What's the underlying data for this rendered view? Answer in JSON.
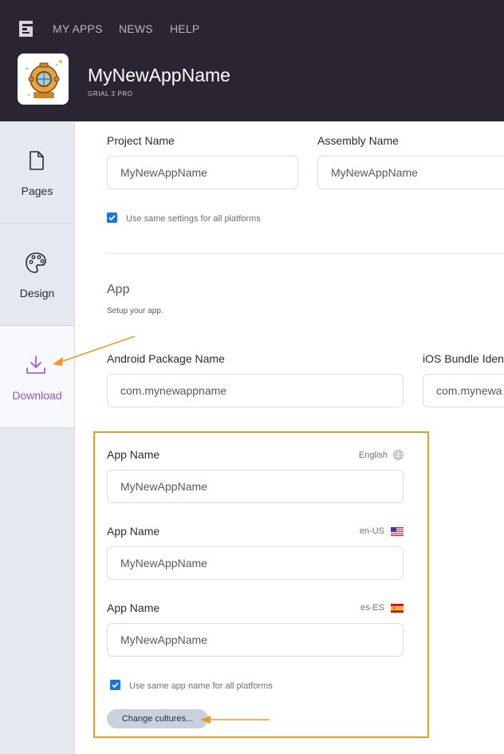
{
  "header": {
    "nav": [
      "MY APPS",
      "NEWS",
      "HELP"
    ],
    "app_title": "MyNewAppName",
    "app_subtitle": "GRIAL 3 PRO"
  },
  "sidebar": {
    "items": [
      {
        "label": "Pages",
        "icon": "page-icon"
      },
      {
        "label": "Design",
        "icon": "palette-icon"
      },
      {
        "label": "Download",
        "icon": "download-icon",
        "active": true
      }
    ]
  },
  "form": {
    "project_name_label": "Project Name",
    "project_name_value": "MyNewAppName",
    "assembly_name_label": "Assembly Name",
    "assembly_name_value": "MyNewAppName",
    "same_settings_label": "Use same settings for all platforms",
    "same_settings_checked": true,
    "app_section_title": "App",
    "app_section_desc": "Setup your app.",
    "android_label": "Android Package Name",
    "android_value": "com.mynewappname",
    "ios_label": "iOS Bundle Iden",
    "ios_value": "com.mynewa",
    "app_names": [
      {
        "label": "App Name",
        "culture": "English",
        "value": "MyNewAppName",
        "icon": "globe-icon"
      },
      {
        "label": "App Name",
        "culture": "en-US",
        "value": "MyNewAppName",
        "icon": "us-flag-icon"
      },
      {
        "label": "App Name",
        "culture": "es-ES",
        "value": "MyNewAppName",
        "icon": "spain-flag-icon"
      }
    ],
    "same_name_label": "Use same app name for all platforms",
    "same_name_checked": true,
    "change_cultures_label": "Change cultures..."
  },
  "colors": {
    "header_bg": "#2b2433",
    "accent": "#9e4ed3",
    "highlight": "#f39a1e",
    "checkbox": "#1a73e8"
  }
}
